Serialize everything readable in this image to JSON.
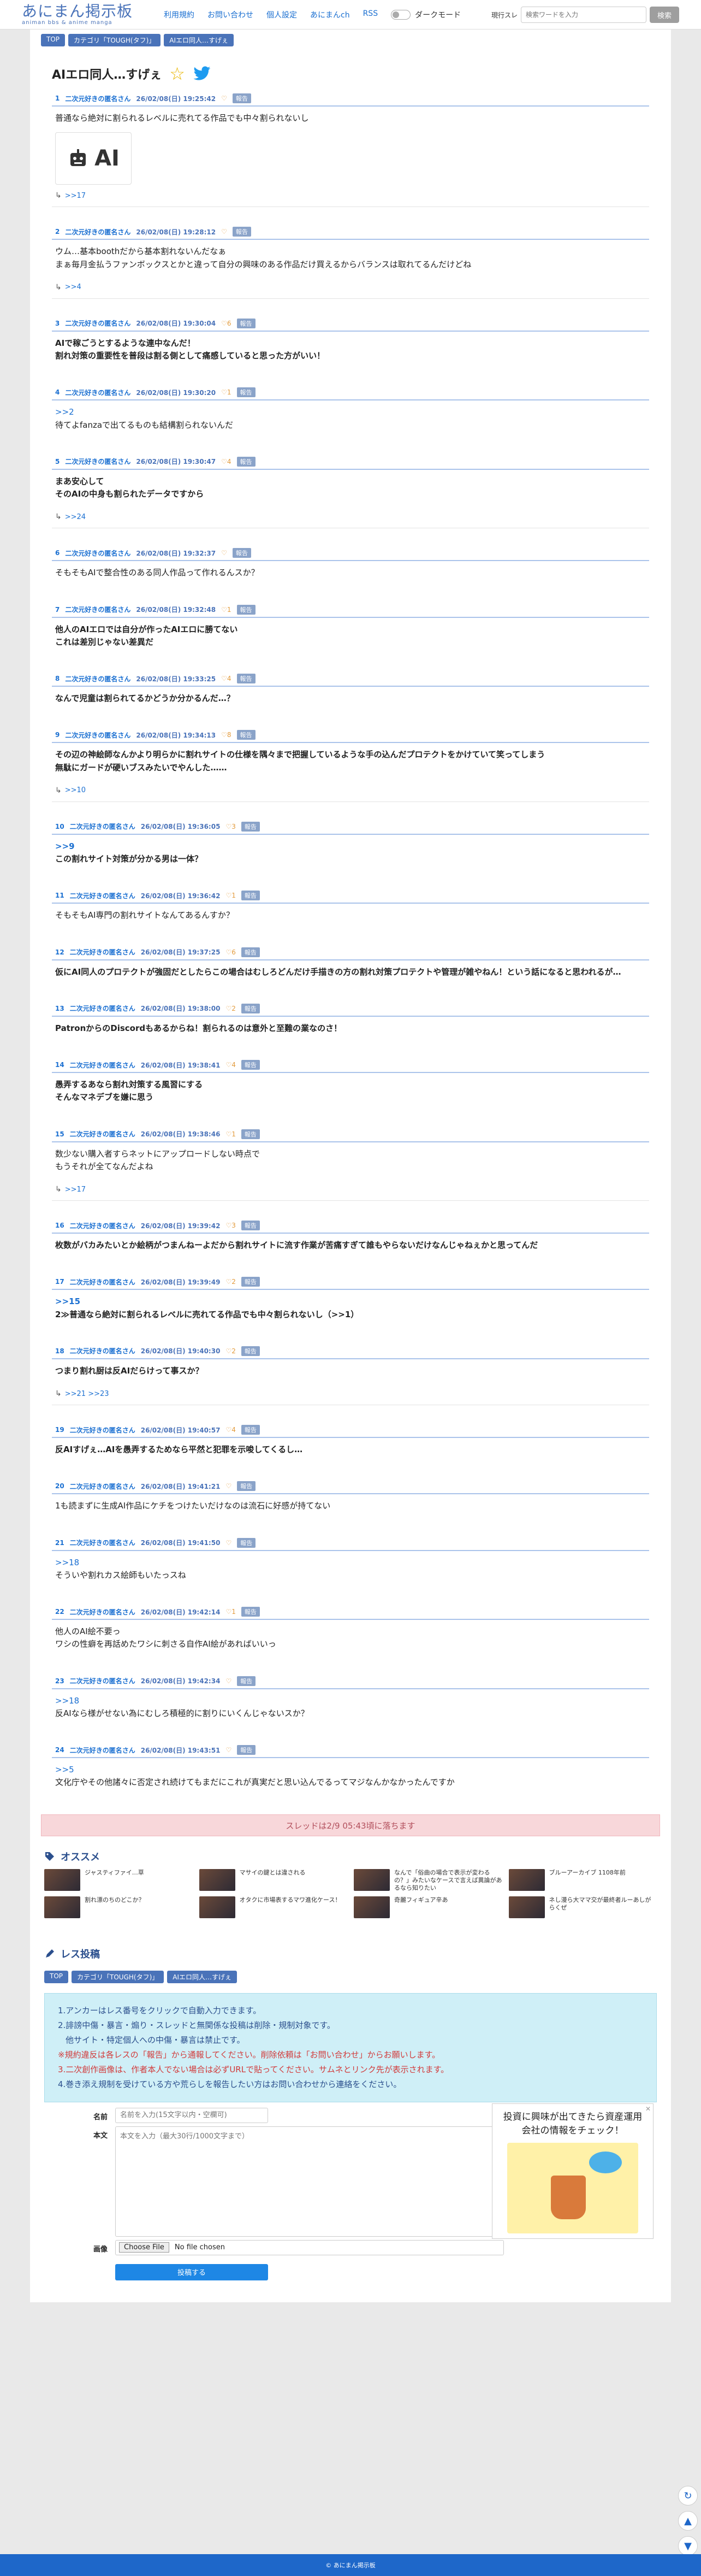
{
  "header": {
    "logo_main": "あにまん掲示板",
    "logo_sub": "animan bbs & anime manga",
    "nav": [
      "利用規約",
      "お問い合わせ",
      "個人設定",
      "あにまんch",
      "RSS"
    ],
    "dark_mode_label": "ダークモード",
    "search_select": "現行スレ",
    "search_placeholder": "検索ワードを入力",
    "search_button": "検索"
  },
  "breadcrumb": [
    "TOP",
    "カテゴリ「TOUGH(タフ)」",
    "AIエロ同人…すげぇ"
  ],
  "thread_title": "AIエロ同人…すげぇ",
  "posts": [
    {
      "no": "1",
      "name": "二次元好きの匿名さん",
      "date": "26/02/08(日) 19:25:42",
      "likes": "",
      "lines": [
        "普通なら絶対に割られるレベルに売れてる作品でも中々割られないし"
      ],
      "bold": false,
      "img": "AI",
      "replies": ">>17"
    },
    {
      "no": "2",
      "name": "二次元好きの匿名さん",
      "date": "26/02/08(日) 19:28:12",
      "likes": "",
      "lines": [
        "ウム…基本boothだから基本割れないんだなぁ",
        "まぁ毎月金払うファンボックスとかと違って自分の興味のある作品だけ買えるからバランスは取れてるんだけどね"
      ],
      "bold": false,
      "replies": ">>4"
    },
    {
      "no": "3",
      "name": "二次元好きの匿名さん",
      "date": "26/02/08(日) 19:30:04",
      "likes": "6",
      "lines": [
        "AIで稼ごうとするような連中なんだ！",
        "割れ対策の重要性を普段は割る側として痛感していると思った方がいい！"
      ],
      "bold": true
    },
    {
      "no": "4",
      "name": "二次元好きの匿名さん",
      "date": "26/02/08(日) 19:30:20",
      "likes": "1",
      "anchor": ">>2",
      "lines": [
        "待てよfanzaで出てるものも結構割られないんだ"
      ],
      "bold": false
    },
    {
      "no": "5",
      "name": "二次元好きの匿名さん",
      "date": "26/02/08(日) 19:30:47",
      "likes": "4",
      "lines": [
        "まあ安心して",
        "そのAIの中身も割られたデータですから"
      ],
      "bold": true,
      "replies": ">>24"
    },
    {
      "no": "6",
      "name": "二次元好きの匿名さん",
      "date": "26/02/08(日) 19:32:37",
      "likes": "",
      "lines": [
        "そもそもAIで整合性のある同人作品って作れるんスか？"
      ],
      "bold": false
    },
    {
      "no": "7",
      "name": "二次元好きの匿名さん",
      "date": "26/02/08(日) 19:32:48",
      "likes": "1",
      "lines": [
        "他人のAIエロでは自分が作ったAIエロに勝てない",
        "これは差別じゃない差異だ"
      ],
      "bold": true
    },
    {
      "no": "8",
      "name": "二次元好きの匿名さん",
      "date": "26/02/08(日) 19:33:25",
      "likes": "4",
      "lines": [
        "なんで児童は割られてるかどうか分かるんだ…？"
      ],
      "bold": true
    },
    {
      "no": "9",
      "name": "二次元好きの匿名さん",
      "date": "26/02/08(日) 19:34:13",
      "likes": "8",
      "lines": [
        "その辺の神絵師なんかより明らかに割れサイトの仕様を隅々まで把握しているような手の込んだプロテクトをかけていて笑ってしまう",
        "無駄にガードが硬いブスみたいでやんした……"
      ],
      "bold": true,
      "replies": ">>10"
    },
    {
      "no": "10",
      "name": "二次元好きの匿名さん",
      "date": "26/02/08(日) 19:36:05",
      "likes": "3",
      "anchor": ">>9",
      "lines": [
        "この割れサイト対策が分かる男は一体？"
      ],
      "bold": true
    },
    {
      "no": "11",
      "name": "二次元好きの匿名さん",
      "date": "26/02/08(日) 19:36:42",
      "likes": "1",
      "lines": [
        "そもそもAI専門の割れサイトなんてあるんすか？"
      ],
      "bold": false
    },
    {
      "no": "12",
      "name": "二次元好きの匿名さん",
      "date": "26/02/08(日) 19:37:25",
      "likes": "6",
      "lines": [
        "仮にAI同人のプロテクトが強固だとしたらこの場合はむしろどんだけ手描きの方の割れ対策プロテクトや管理が雑やねん！という話になると思われるが…"
      ],
      "bold": true
    },
    {
      "no": "13",
      "name": "二次元好きの匿名さん",
      "date": "26/02/08(日) 19:38:00",
      "likes": "2",
      "lines": [
        "PatronからのDiscordもあるからね！割られるのは意外と至難の業なのさ！"
      ],
      "bold": true
    },
    {
      "no": "14",
      "name": "二次元好きの匿名さん",
      "date": "26/02/08(日) 19:38:41",
      "likes": "4",
      "lines": [
        "愚弄するあなら割れ対策する風習にする",
        "そんなマネデブを嫌に思う"
      ],
      "bold": true
    },
    {
      "no": "15",
      "name": "二次元好きの匿名さん",
      "date": "26/02/08(日) 19:38:46",
      "likes": "1",
      "lines": [
        "数少ない購入者すらネットにアップロードしない時点で",
        "もうそれが全てなんだよね"
      ],
      "bold": false,
      "replies": ">>17"
    },
    {
      "no": "16",
      "name": "二次元好きの匿名さん",
      "date": "26/02/08(日) 19:39:42",
      "likes": "3",
      "lines": [
        "枚数がバカみたいとか絵柄がつまんねーよだから割れサイトに流す作業が苦痛すぎて誰もやらないだけなんじゃねぇかと思ってんだ"
      ],
      "bold": true
    },
    {
      "no": "17",
      "name": "二次元好きの匿名さん",
      "date": "26/02/08(日) 19:39:49",
      "likes": "2",
      "anchor": ">>15",
      "lines": [
        "2≫普通なら絶対に割られるレベルに売れてる作品でも中々割られないし（>>1）"
      ],
      "bold": true
    },
    {
      "no": "18",
      "name": "二次元好きの匿名さん",
      "date": "26/02/08(日) 19:40:30",
      "likes": "2",
      "lines": [
        "つまり割れ厨は反AIだらけって事スか？"
      ],
      "bold": true,
      "replies": ">>21 >>23"
    },
    {
      "no": "19",
      "name": "二次元好きの匿名さん",
      "date": "26/02/08(日) 19:40:57",
      "likes": "4",
      "lines": [
        "反AIすげぇ…AIを愚弄するためなら平然と犯罪を示唆してくるし…"
      ],
      "bold": true
    },
    {
      "no": "20",
      "name": "二次元好きの匿名さん",
      "date": "26/02/08(日) 19:41:21",
      "likes": "",
      "lines": [
        "1も読まずに生成AI作品にケチをつけたいだけなのは流石に好感が持てない"
      ],
      "bold": false
    },
    {
      "no": "21",
      "name": "二次元好きの匿名さん",
      "date": "26/02/08(日) 19:41:50",
      "likes": "",
      "anchor": ">>18",
      "lines": [
        "そういや割れカス絵師もいたっスね"
      ],
      "bold": false
    },
    {
      "no": "22",
      "name": "二次元好きの匿名さん",
      "date": "26/02/08(日) 19:42:14",
      "likes": "1",
      "lines": [
        "他人のAI絵不要っ",
        "ワシの性癖を再話めたワシに刺さる自作AI絵があればいいっ"
      ],
      "bold": false
    },
    {
      "no": "23",
      "name": "二次元好きの匿名さん",
      "date": "26/02/08(日) 19:42:34",
      "likes": "",
      "anchor": ">>18",
      "lines": [
        "反AIなら様がせない為にむしろ積極的に割りにいくんじゃないスか？"
      ],
      "bold": false
    },
    {
      "no": "24",
      "name": "二次元好きの匿名さん",
      "date": "26/02/08(日) 19:43:51",
      "likes": "",
      "anchor": ">>5",
      "lines": [
        "文化庁やその他諸々に否定され続けてもまだにこれが真実だと思い込んでるってマジなんかなかったんですか"
      ],
      "bold": false
    }
  ],
  "report_label": "報告",
  "expire_notice": "スレッドは2/9 05:43頃に落ちます",
  "recommend": {
    "title": "オススメ",
    "items": [
      "ジャスティファイ…草",
      "マサイの鍵とは違される",
      "なんで「俗曲の場合で表示が変わるの？」みたいなケースで言えば異論があるなら知りたい",
      "ブルーアーカイブ 1108年前",
      "割れ漂のちのどこか？",
      "オタクに市場表するマワ進化ケース！",
      "奇麗フィギュア辛あ",
      "ネし漫ら大ママ交が最終者ルーあしがらくぜ"
    ]
  },
  "form": {
    "title": "レス投稿",
    "rules": [
      "1.アンカーはレス番号をクリックで自動入力できます。",
      "2.誹謗中傷・暴言・煽り・スレッドと無関係な投稿は削除・規制対象です。",
      "他サイト・特定個人への中傷・暴言は禁止です。",
      "※規約違反は各レスの「報告」から通報してください。削除依頼は「お問い合わせ」からお願いします。",
      "3.二次創作画像は、作者本人でない場合は必ずURLで貼ってください。サムネとリンク先が表示されます。",
      "4.巻き添え規制を受けている方や荒らしを報告したい方はお問い合わせから連絡をください。"
    ],
    "name_label": "名前",
    "name_placeholder": "名前を入力(15文字以内・空欄可)",
    "body_label": "本文",
    "body_placeholder": "本文を入力（最大30行/1000文字まで）",
    "image_label": "画像",
    "file_button": "Choose File",
    "file_status": "No file chosen",
    "submit": "投稿する"
  },
  "ad": {
    "text": "投資に興味が出てきたら資産運用会社の情報をチェック！"
  },
  "footer": "© あにまん掲示板"
}
